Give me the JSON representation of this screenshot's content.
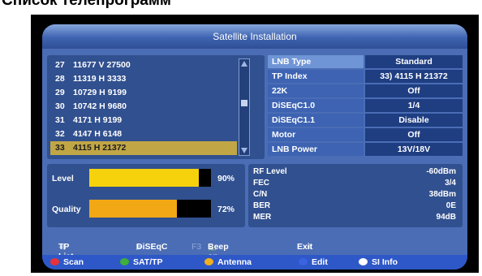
{
  "page_caption": "Список телепрограмм",
  "window": {
    "title": "Satellite Installation"
  },
  "channels": [
    {
      "num": "27",
      "label": "11677 V 27500"
    },
    {
      "num": "28",
      "label": "11319 H 3333"
    },
    {
      "num": "29",
      "label": "10729 H 9199"
    },
    {
      "num": "30",
      "label": "10742 H 9680"
    },
    {
      "num": "31",
      "label": "4171 H 9199"
    },
    {
      "num": "32",
      "label": "4147 H 6148"
    },
    {
      "num": "33",
      "label": "4115 H 21372"
    }
  ],
  "selected_channel_index": 6,
  "settings": [
    {
      "label": "LNB Type",
      "value": "Standard"
    },
    {
      "label": "TP Index",
      "value": "33) 4115 H 21372"
    },
    {
      "label": "22K",
      "value": "Off"
    },
    {
      "label": "DiSEqC1.0",
      "value": "1/4"
    },
    {
      "label": "DiSEqC1.1",
      "value": "Disable"
    },
    {
      "label": "Motor",
      "value": "Off"
    },
    {
      "label": "LNB Power",
      "value": "13V/18V"
    }
  ],
  "signal": {
    "level": {
      "label": "Level",
      "percent_text": "90%",
      "fraction": 0.9,
      "color": "#f6d20c"
    },
    "quality": {
      "label": "Quality",
      "percent_text": "72%",
      "fraction": 0.72,
      "color": "#f2a715"
    }
  },
  "stats": [
    {
      "label": "RF Level",
      "value": "-60dBm"
    },
    {
      "label": "FEC",
      "value": "3/4"
    },
    {
      "label": "C/N",
      "value": "38dBm"
    },
    {
      "label": "BER",
      "value": "0E"
    },
    {
      "label": "MER",
      "value": "94dB"
    }
  ],
  "nav": {
    "tp_list": "TP List",
    "diseqc": "DiSEqC",
    "f3_key": "F3",
    "beep": "Beep on",
    "exit_key": "Exit",
    "exit_label": "Exit"
  },
  "color_buttons": [
    {
      "label": "Scan",
      "color": "#e8323a"
    },
    {
      "label": "SAT/TP",
      "color": "#3fae3a"
    },
    {
      "label": "Antenna",
      "color": "#f0b020"
    },
    {
      "label": "Edit",
      "color": "#3a63e0"
    },
    {
      "label": "SI Info",
      "color": "#ffffff"
    }
  ]
}
